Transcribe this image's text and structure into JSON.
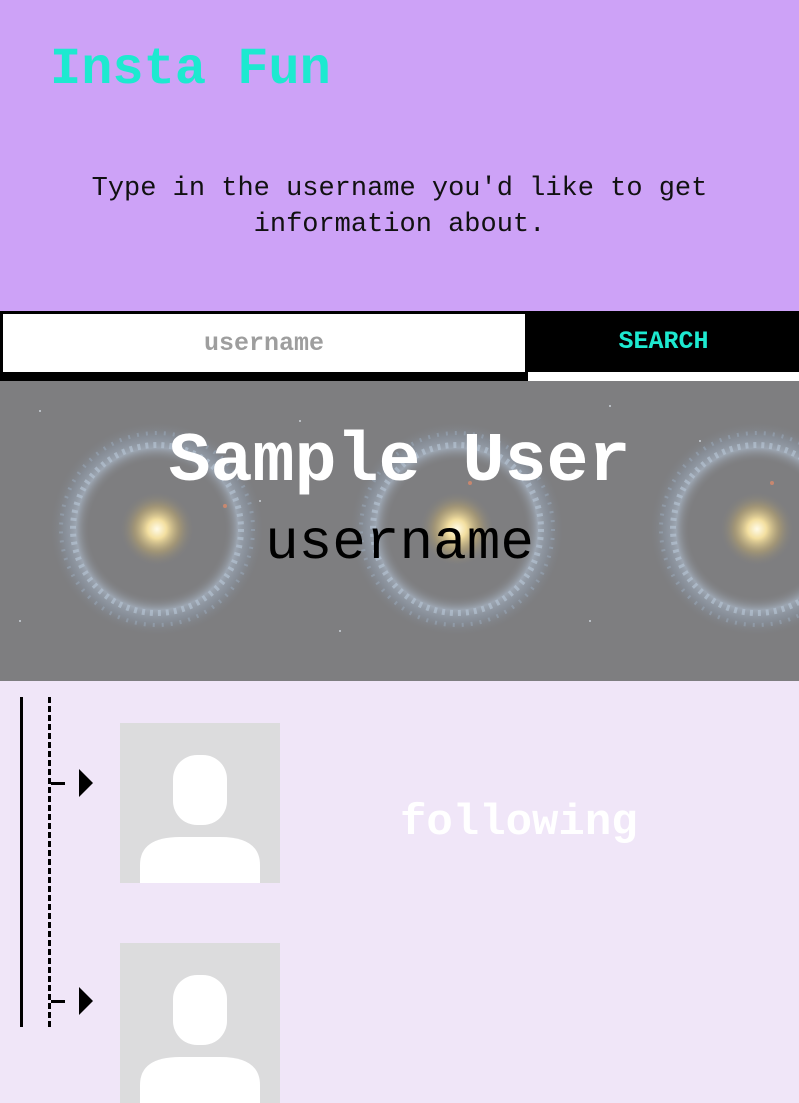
{
  "header": {
    "app_title": "Insta Fun",
    "instructions": "Type in the username you'd like to get information about.",
    "background_color": "#cda2f7",
    "title_color": "#1de9d0"
  },
  "search": {
    "placeholder": "username",
    "value": "",
    "button_label": "SEARCH"
  },
  "profile": {
    "display_name": "Sample User",
    "username": "username",
    "banner_image": "galaxy-ring-image"
  },
  "following": {
    "label": "following",
    "items": [
      {
        "avatar_icon": "default-user-avatar-icon"
      },
      {
        "avatar_icon": "default-user-avatar-icon"
      }
    ]
  }
}
